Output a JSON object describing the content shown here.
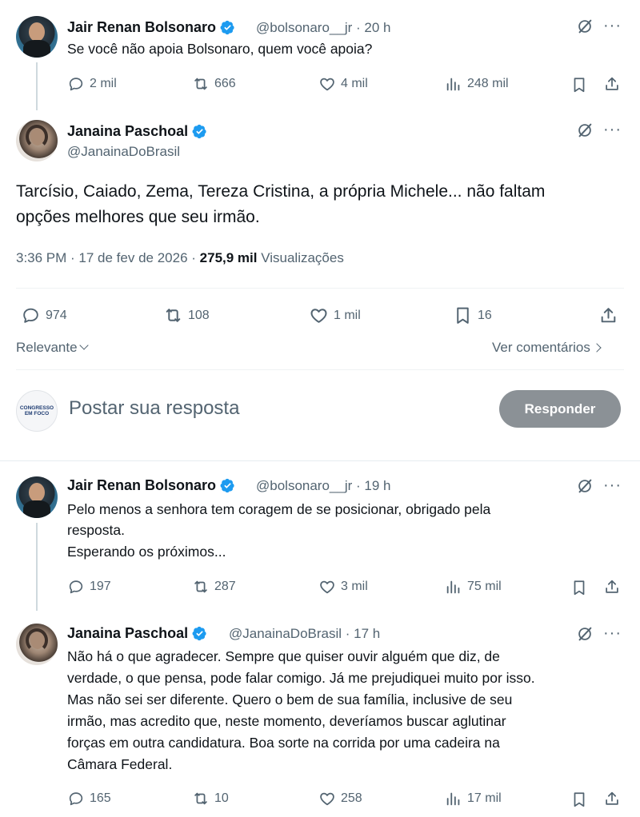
{
  "tweet1": {
    "name": "Jair Renan Bolsonaro",
    "handle_time": "@bolsonaro__jr · 20 h",
    "text": "Se você não apoia Bolsonaro, quem você apoia?",
    "replies": "2 mil",
    "reposts": "666",
    "likes": "4 mil",
    "views": "248 mil"
  },
  "main_tweet": {
    "name": "Janaina Paschoal",
    "handle": "@JanainaDoBrasil",
    "text_line1": "Tarcísio, Caiado, Zema, Tereza Cristina, a própria Michele... não faltam",
    "text_line2": "opções melhores que seu irmão.",
    "timestamp": "3:36 PM · 17 de fev de 2026 · ",
    "views_count": "275,9 mil",
    "views_label": " Visualizações",
    "replies": "974",
    "reposts": "108",
    "likes": "1 mil",
    "bookmarks": "16"
  },
  "sort": {
    "relevant_label": "Relevante",
    "see_comments_label": "Ver comentários"
  },
  "composer": {
    "avatar_text": "CONGRESSO EM FOCO",
    "placeholder": "Postar sua resposta",
    "button_label": "Responder"
  },
  "reply1": {
    "name": "Jair Renan Bolsonaro",
    "handle_time": "@bolsonaro__jr · 19 h",
    "line1": "Pelo menos a senhora tem coragem de se posicionar, obrigado pela",
    "line2": "resposta.",
    "line3": "Esperando os próximos...",
    "replies": "197",
    "reposts": "287",
    "likes": "3 mil",
    "views": "75 mil"
  },
  "reply2": {
    "name": "Janaina Paschoal",
    "handle_time": "@JanainaDoBrasil · 17 h",
    "line1": "Não há o que agradecer. Sempre que quiser ouvir alguém que diz, de",
    "line2": "verdade, o que pensa, pode falar comigo. Já me prejudiquei muito por isso.",
    "line3": "Mas não sei ser diferente. Quero o bem de sua família, inclusive de seu",
    "line4": "irmão, mas acredito que, neste momento, deveríamos buscar aglutinar",
    "line5": "forças em outra candidatura. Boa sorte na corrida por uma cadeira na",
    "line6": "Câmara Federal.",
    "replies": "165",
    "reposts": "10",
    "likes": "258",
    "views": "17 mil"
  },
  "colors": {
    "text": "#0f1419",
    "secondary": "#536471",
    "verified": "#1d9bf0",
    "divider": "#eff3f4",
    "button": "#8b9196"
  }
}
